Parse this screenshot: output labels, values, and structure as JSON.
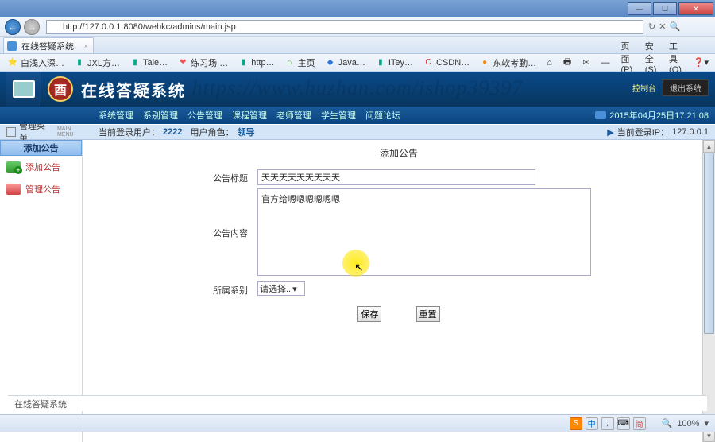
{
  "window": {
    "min": "—",
    "max": "☐",
    "close": "✕"
  },
  "address": {
    "url": "http://127.0.0.1:8080/webkc/admins/main.jsp",
    "back": "←",
    "forward": "→",
    "refresh": "↻",
    "stop": "✕",
    "search": "🔍"
  },
  "tab": {
    "title": "在线答疑系统",
    "close": "×"
  },
  "bookmarks": {
    "items": [
      {
        "icon": "⭐",
        "cls": "star",
        "label": "白浅入深…"
      },
      {
        "icon": "▮",
        "cls": "tall",
        "label": "JXL方…"
      },
      {
        "icon": "▮",
        "cls": "tall",
        "label": "Tale…"
      },
      {
        "icon": "❤",
        "cls": "heart",
        "label": "练习场 …"
      },
      {
        "icon": "▮",
        "cls": "tall",
        "label": "http…"
      },
      {
        "icon": "⌂",
        "cls": "house",
        "label": "主页"
      },
      {
        "icon": "◆",
        "cls": "blue",
        "label": "Java…"
      },
      {
        "icon": "▮",
        "cls": "tall",
        "label": "ITey…"
      },
      {
        "icon": "C",
        "cls": "red",
        "label": "CSDN…"
      },
      {
        "icon": "●",
        "cls": "orange",
        "label": "东软考勤…"
      }
    ],
    "right": [
      "页面(P) ▾",
      "安全(S) ▾",
      "工具(O) ▾",
      "❓▾"
    ]
  },
  "app": {
    "logo_char": "酉",
    "title": "在线答疑系统",
    "top_right_label": "控制台",
    "top_right_btn": "退出系统",
    "nav": [
      "系统管理",
      "系别管理",
      "公告管理",
      "课程管理",
      "老师管理",
      "学生管理",
      "问题论坛"
    ],
    "timestamp": "2015年04月25日17:21:08"
  },
  "watermark": "https://www.huzhan.com/ishop39397",
  "infobar": {
    "left_prefix": "当前登录用户：",
    "user_id": "2222",
    "role_prefix": "用户角色：",
    "role": "领导",
    "right_prefix": "当前登录IP：",
    "ip": "127.0.0.1",
    "arrow": "▶"
  },
  "sidebar": {
    "header": "管理菜单",
    "header_sub": "MAIN MENU",
    "active": "添加公告",
    "items": [
      {
        "label": "添加公告",
        "ico": "add"
      },
      {
        "label": "管理公告",
        "ico": "mg"
      }
    ]
  },
  "form": {
    "title": "添加公告",
    "label_subject": "公告标题",
    "value_subject": "天天天天天天天天天",
    "label_content": "公告内容",
    "value_content": "官方给嗯嗯嗯嗯嗯嗯",
    "label_dept": "所属系别",
    "dept_placeholder": "请选择..",
    "save": "保存",
    "reset": "重置"
  },
  "footer": "在线答疑系统",
  "status": {
    "ime": [
      "S",
      "中",
      ",",
      "⌨",
      "简"
    ],
    "zoom": "100%"
  }
}
